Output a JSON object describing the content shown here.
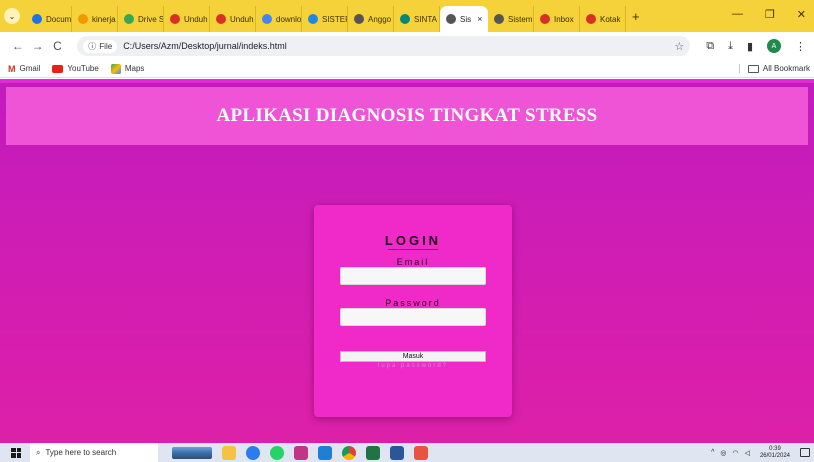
{
  "browser": {
    "tabs": [
      {
        "label": "Docum",
        "color": "#1a73e8",
        "active": false
      },
      {
        "label": "kinerja",
        "color": "#f29900",
        "active": false
      },
      {
        "label": "Drive S",
        "color": "#34a853",
        "active": false
      },
      {
        "label": "Unduh",
        "color": "#d93025",
        "active": false
      },
      {
        "label": "Unduh",
        "color": "#d93025",
        "active": false
      },
      {
        "label": "downlo",
        "color": "#4285f4",
        "active": false
      },
      {
        "label": "SISTER",
        "color": "#1e88e5",
        "active": false
      },
      {
        "label": "Anggo",
        "color": "#555555",
        "active": false
      },
      {
        "label": "SINTA",
        "color": "#00897b",
        "active": false
      },
      {
        "label": "Sis",
        "color": "#555555",
        "active": true
      },
      {
        "label": "Sistem",
        "color": "#555555",
        "active": false
      },
      {
        "label": "Inbox",
        "color": "#d93025",
        "active": false
      },
      {
        "label": "Kotak",
        "color": "#d93025",
        "active": false
      }
    ],
    "close_tab": "×",
    "new_tab": "+",
    "window_controls": {
      "minimize": "—",
      "restore": "❐",
      "close": "✕"
    },
    "nav": {
      "back": "←",
      "forward": "→",
      "reload": "C"
    },
    "site_chip": "File",
    "url": "C:/Users/Azm/Desktop/jurnal/indeks.html",
    "bookmarks": [
      {
        "label": "Gmail",
        "icon": "gmail-icon"
      },
      {
        "label": "YouTube",
        "icon": "youtube-icon"
      },
      {
        "label": "Maps",
        "icon": "maps-icon"
      }
    ],
    "all_bookmarks": "All Bookmark",
    "profile_initial": "A"
  },
  "page": {
    "title": "APLIKASI DIAGNOSIS TINGKAT STRESS",
    "login": {
      "heading": "LOGIN",
      "email_label": "Email",
      "email_value": "",
      "password_label": "Password",
      "password_value": "",
      "submit_label": "Masuk",
      "forgot_label": "lupa password?"
    }
  },
  "colors": {
    "tab_strip": "#f6d23a",
    "page_bg": "#c21cbe",
    "header_bg": "#ef53d6",
    "card_bg": "#f02ac9"
  },
  "taskbar": {
    "search_placeholder": "Type here to search",
    "time": "0:39",
    "date": "26/01/2024"
  }
}
